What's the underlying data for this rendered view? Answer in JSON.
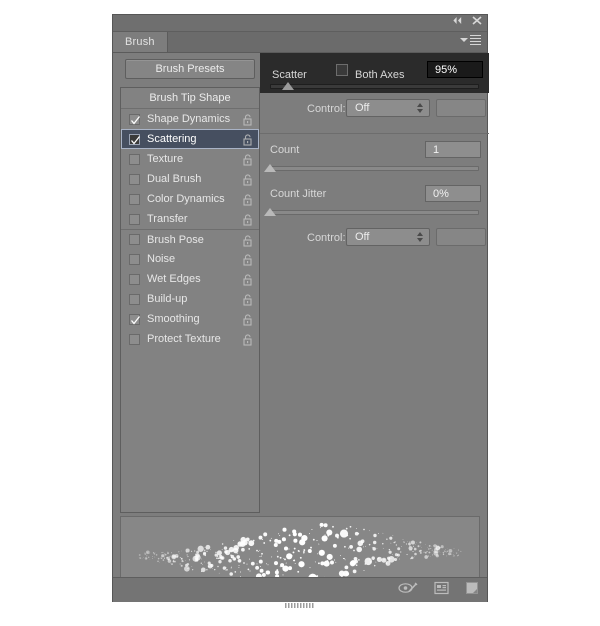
{
  "window": {
    "collapse_icon": "collapse-to-icons",
    "close_icon": "close-panel"
  },
  "tab": {
    "label": "Brush"
  },
  "panel_menu": {
    "icon": "panel-menu-icon"
  },
  "left": {
    "presets_button": "Brush Presets",
    "list_header": "Brush Tip Shape",
    "items": [
      {
        "label": "Shape Dynamics",
        "checked": true,
        "selected": false,
        "locked": false
      },
      {
        "label": "Scattering",
        "checked": true,
        "selected": true,
        "locked": false
      },
      {
        "label": "Texture",
        "checked": false,
        "selected": false,
        "locked": false
      },
      {
        "label": "Dual Brush",
        "checked": false,
        "selected": false,
        "locked": false
      },
      {
        "label": "Color Dynamics",
        "checked": false,
        "selected": false,
        "locked": false
      },
      {
        "label": "Transfer",
        "checked": false,
        "selected": false,
        "locked": false
      },
      {
        "label": "Brush Pose",
        "checked": false,
        "selected": false,
        "locked": false
      },
      {
        "label": "Noise",
        "checked": false,
        "selected": false,
        "locked": false
      },
      {
        "label": "Wet Edges",
        "checked": false,
        "selected": false,
        "locked": false
      },
      {
        "label": "Build-up",
        "checked": false,
        "selected": false,
        "locked": false
      },
      {
        "label": "Smoothing",
        "checked": true,
        "selected": false,
        "locked": false
      },
      {
        "label": "Protect Texture",
        "checked": false,
        "selected": false,
        "locked": false
      }
    ]
  },
  "right": {
    "scatter": {
      "label": "Scatter",
      "both_axes_label": "Both Axes",
      "both_axes_checked": false,
      "value": "95%",
      "slider_percent": 10
    },
    "scatter_control": {
      "label": "Control:",
      "value": "Off"
    },
    "count": {
      "label": "Count",
      "value": "1",
      "slider_percent": 0
    },
    "count_jitter": {
      "label": "Count Jitter",
      "value": "0%",
      "slider_percent": 0
    },
    "count_jitter_control": {
      "label": "Control:",
      "value": "Off"
    }
  },
  "preview": {
    "name": "brush-stroke-preview"
  },
  "footer": {
    "icons": [
      {
        "name": "toggle-brush-preview-icon"
      },
      {
        "name": "open-preset-manager-icon"
      },
      {
        "name": "new-brush-preset-icon"
      }
    ],
    "grip": "resize-grip"
  },
  "colors": {
    "panel_bg": "#7d7d7d",
    "dark_overlay": "#2b2b2b",
    "selection": "#464f60",
    "text": "#e7e7e7"
  }
}
